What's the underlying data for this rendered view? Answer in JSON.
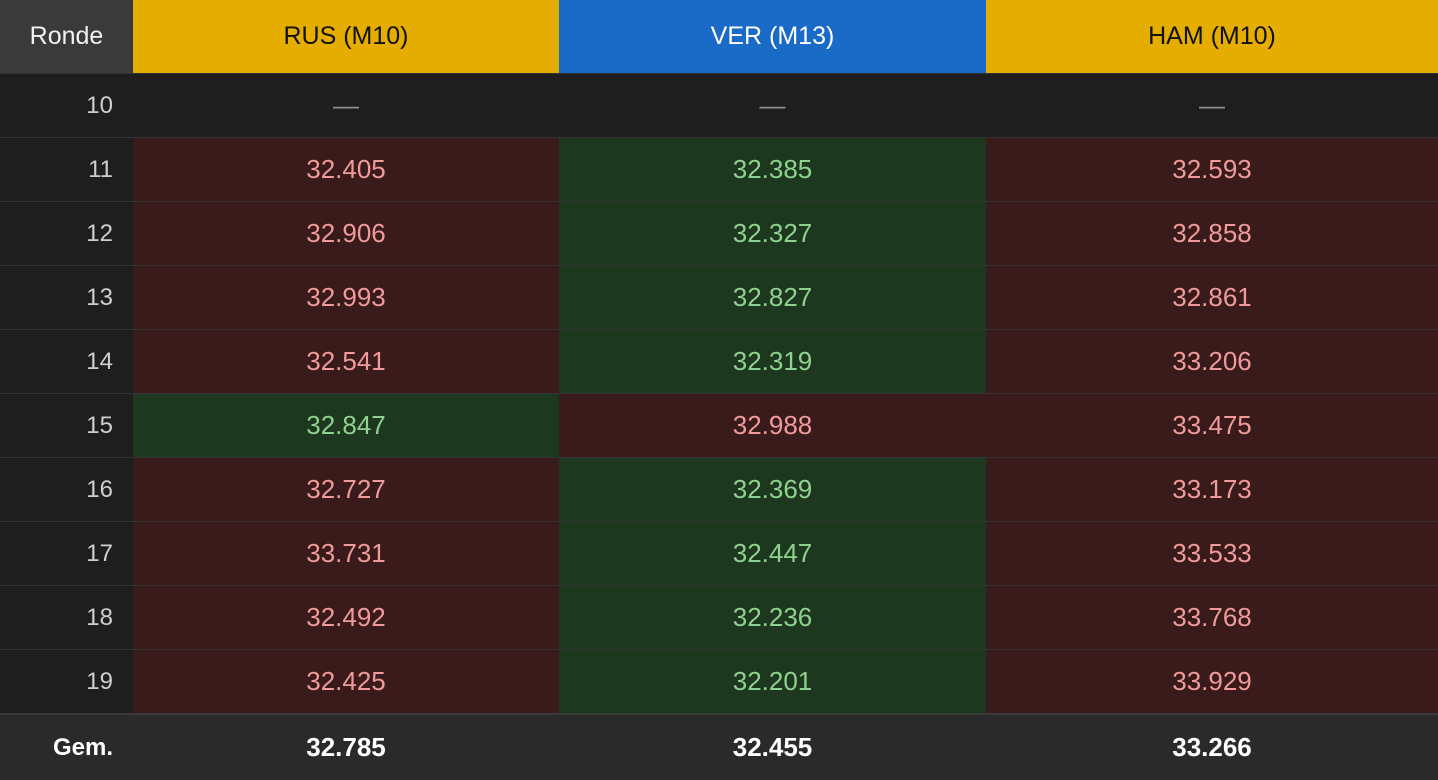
{
  "table": {
    "round_header": "Ronde",
    "columns": [
      {
        "label": "RUS (M10)",
        "color": "#e5ad00"
      },
      {
        "label": "VER (M13)",
        "color": "#1a6ac7"
      },
      {
        "label": "HAM (M10)",
        "color": "#e5ad00"
      }
    ],
    "rows": [
      {
        "round": "10",
        "cells": [
          {
            "v": "—",
            "s": "none"
          },
          {
            "v": "—",
            "s": "none"
          },
          {
            "v": "—",
            "s": "none"
          }
        ]
      },
      {
        "round": "11",
        "cells": [
          {
            "v": "32.405",
            "s": "neg"
          },
          {
            "v": "32.385",
            "s": "pos"
          },
          {
            "v": "32.593",
            "s": "neg"
          }
        ]
      },
      {
        "round": "12",
        "cells": [
          {
            "v": "32.906",
            "s": "neg"
          },
          {
            "v": "32.327",
            "s": "pos"
          },
          {
            "v": "32.858",
            "s": "neg"
          }
        ]
      },
      {
        "round": "13",
        "cells": [
          {
            "v": "32.993",
            "s": "neg"
          },
          {
            "v": "32.827",
            "s": "pos"
          },
          {
            "v": "32.861",
            "s": "neg"
          }
        ]
      },
      {
        "round": "14",
        "cells": [
          {
            "v": "32.541",
            "s": "neg"
          },
          {
            "v": "32.319",
            "s": "pos"
          },
          {
            "v": "33.206",
            "s": "neg"
          }
        ]
      },
      {
        "round": "15",
        "cells": [
          {
            "v": "32.847",
            "s": "pos"
          },
          {
            "v": "32.988",
            "s": "neg"
          },
          {
            "v": "33.475",
            "s": "neg"
          }
        ]
      },
      {
        "round": "16",
        "cells": [
          {
            "v": "32.727",
            "s": "neg"
          },
          {
            "v": "32.369",
            "s": "pos"
          },
          {
            "v": "33.173",
            "s": "neg"
          }
        ]
      },
      {
        "round": "17",
        "cells": [
          {
            "v": "33.731",
            "s": "neg"
          },
          {
            "v": "32.447",
            "s": "pos"
          },
          {
            "v": "33.533",
            "s": "neg"
          }
        ]
      },
      {
        "round": "18",
        "cells": [
          {
            "v": "32.492",
            "s": "neg"
          },
          {
            "v": "32.236",
            "s": "pos"
          },
          {
            "v": "33.768",
            "s": "neg"
          }
        ]
      },
      {
        "round": "19",
        "cells": [
          {
            "v": "32.425",
            "s": "neg"
          },
          {
            "v": "32.201",
            "s": "pos"
          },
          {
            "v": "33.929",
            "s": "neg"
          }
        ]
      }
    ],
    "footer": {
      "label": "Gem.",
      "values": [
        "32.785",
        "32.455",
        "33.266"
      ]
    }
  },
  "colors": {
    "negative_bg": "#3a1b1c",
    "positive_bg": "#1e381f",
    "negative_text": "#f09a9a",
    "positive_text": "#8fd18f"
  }
}
